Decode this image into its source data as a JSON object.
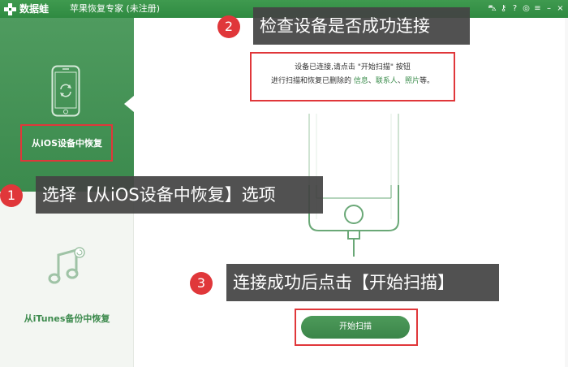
{
  "titlebar": {
    "logo_text": "数据蛙",
    "app_title": "苹果恢复专家 (未注册)",
    "controls": [
      "cart-icon",
      "key-icon",
      "help-icon",
      "chat-icon",
      "menu-icon",
      "minimize-icon",
      "close-icon"
    ],
    "control_glyphs": [
      "⛍",
      "⚷",
      "?",
      "◎",
      "≡",
      "–",
      "×"
    ]
  },
  "sidebar": {
    "items": [
      {
        "label": "从iOS设备中恢复",
        "active": true,
        "icon": "phone-restore-icon"
      },
      {
        "label": "从iTunes备份中恢复",
        "active": false,
        "icon": "music-note-icon"
      }
    ]
  },
  "main": {
    "message": {
      "line1": "设备已连接,请点击 \"开始扫描\" 按钮",
      "line2_prefix": "进行扫描和恢复已删除的",
      "link_info": "信息",
      "sep1": "、",
      "link_contacts": "联系人",
      "sep2": "、",
      "link_photos": "照片",
      "line2_suffix": "等。"
    },
    "start_button": "开始扫描"
  },
  "annotations": [
    {
      "number": "1",
      "text": "选择【从iOS设备中恢复】选项"
    },
    {
      "number": "2",
      "text": "检查设备是否成功连接"
    },
    {
      "number": "3",
      "text": "连接成功后点击【开始扫描】"
    }
  ],
  "colors": {
    "brand_green": "#3b8a4d",
    "annotation_red": "#e0373a",
    "callout_bg": "#444444"
  }
}
